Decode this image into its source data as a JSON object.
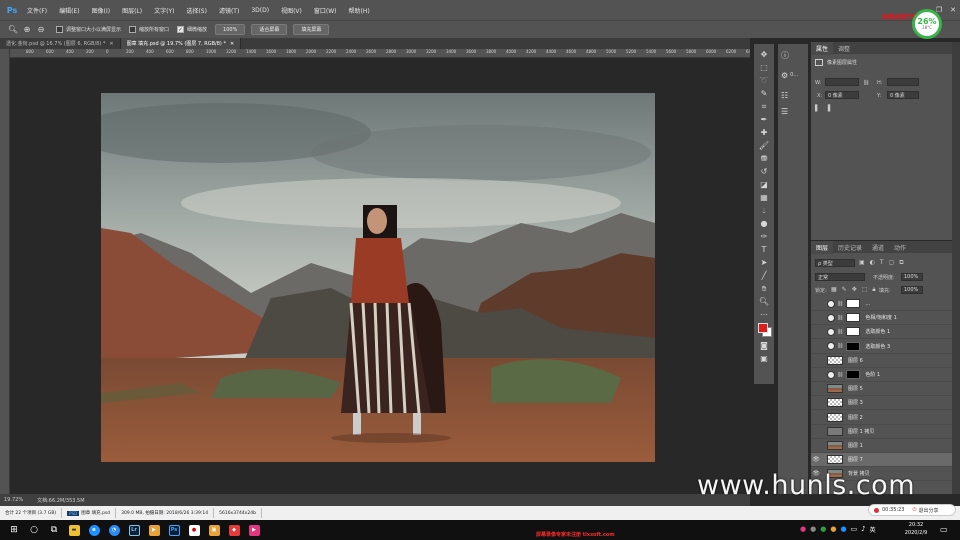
{
  "app": {
    "logo": "Ps",
    "menu": [
      "文件(F)",
      "编辑(E)",
      "图像(I)",
      "图层(L)",
      "文字(Y)",
      "选择(S)",
      "滤镜(T)",
      "3D(D)",
      "视图(V)",
      "窗口(W)",
      "帮助(H)"
    ],
    "window_controls": [
      "—",
      "❐",
      "✕"
    ]
  },
  "badge": {
    "percent": "26%",
    "temp": "38°C"
  },
  "top_watermark": "屏幕录像专家 未注册",
  "options_bar": {
    "check_resize_windows": "调整窗口大小以满屏显示",
    "check_zoom_all": "缩放所有窗口",
    "check_scrubby": "细微缩放",
    "btn_100": "100%",
    "btn_fit": "适合屏幕",
    "btn_fill": "填充屏幕"
  },
  "tabs": [
    {
      "label": "透化.金衔.psd @ 16.7% (图层 6, RGB/8) *",
      "active": false
    },
    {
      "label": "图章 填充.psd @ 19.7% (图层 7, RGB/8) *",
      "active": true
    }
  ],
  "ruler_top_labels": [
    "800",
    "600",
    "400",
    "200",
    "0",
    "200",
    "400",
    "600",
    "800",
    "1000",
    "1200",
    "1400",
    "1600",
    "1800",
    "2000",
    "2200",
    "2400",
    "2600",
    "2800",
    "3000",
    "3200",
    "3400",
    "3600",
    "3800",
    "4000",
    "4200",
    "4400",
    "4600",
    "4800",
    "5000",
    "5200",
    "5400",
    "5600",
    "5800",
    "6000",
    "6200",
    "6400"
  ],
  "status_bar": {
    "zoom": "19.72%",
    "doc": "文档:66.2M/353.5M"
  },
  "properties": {
    "tabs": [
      "属性",
      "调整"
    ],
    "title": "像素图层属性",
    "w_label": "W:",
    "h_label": "H:",
    "x_label": "X:",
    "x_value": "0 像素",
    "y_label": "Y:",
    "y_value": "0 像素"
  },
  "icon_column": {
    "item2": "0..."
  },
  "layers_panel": {
    "tabs": [
      "图层",
      "历史记录",
      "通道",
      "动作"
    ],
    "kind_filter": "ρ 类型",
    "blend_mode": "正常",
    "opacity_label": "不透明度:",
    "opacity_value": "100%",
    "lock_label": "锁定:",
    "fill_label": "填充:",
    "fill_value": "100%",
    "layers": [
      {
        "name": "...",
        "kind": "adj-white",
        "eye": false
      },
      {
        "name": "色相/饱和度 1",
        "kind": "adj-white",
        "eye": false
      },
      {
        "name": "选取颜色 1",
        "kind": "adj-white",
        "eye": false
      },
      {
        "name": "选取颜色 3",
        "kind": "adj-black",
        "eye": false
      },
      {
        "name": "图层 6",
        "kind": "checker",
        "eye": false
      },
      {
        "name": "色阶 1",
        "kind": "adj-black",
        "eye": false
      },
      {
        "name": "图层 5",
        "kind": "photo",
        "eye": false
      },
      {
        "name": "图层 3",
        "kind": "checker",
        "eye": false
      },
      {
        "name": "图层 2",
        "kind": "checker",
        "eye": false
      },
      {
        "name": "图层 1 拷贝",
        "kind": "gray",
        "eye": false
      },
      {
        "name": "图层 1",
        "kind": "photo",
        "eye": false
      },
      {
        "name": "图层 7",
        "kind": "checker",
        "eye": true,
        "selected": true
      },
      {
        "name": "背景 拷贝",
        "kind": "photo",
        "eye": true
      }
    ]
  },
  "watermark": "www.hunls.com",
  "doc_info": [
    "合计 22 个项目 (3.7 GB)",
    "图章 填充.psd",
    "309.0 MB, 拍摄日期: 2018/6/26 3:39:14",
    "5616x3744x24b"
  ],
  "recorder": {
    "time": "00:35:23",
    "share": "退出分享"
  },
  "taskbar": {
    "red_text": "屏幕录像专家未注册 tlxsoft.com",
    "ime": "英",
    "time": "20:32",
    "date": "2020/2/9"
  }
}
